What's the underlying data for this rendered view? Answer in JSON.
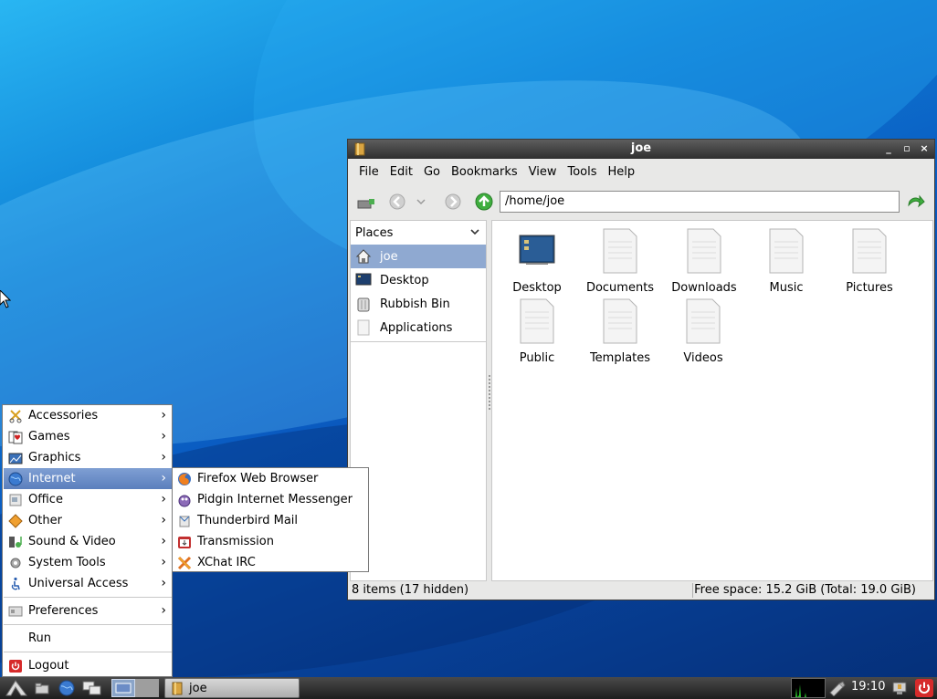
{
  "window": {
    "title": "joe",
    "controls": {
      "minimize": "_",
      "maximize": "▫",
      "close": "×"
    }
  },
  "menubar": {
    "items": [
      {
        "label": "File"
      },
      {
        "label": "Edit"
      },
      {
        "label": "Go"
      },
      {
        "label": "Bookmarks"
      },
      {
        "label": "View"
      },
      {
        "label": "Tools"
      },
      {
        "label": "Help"
      }
    ]
  },
  "toolbar": {
    "location_value": "/home/joe",
    "icons": [
      "new-tab-icon",
      "back-icon",
      "history-dropdown-icon",
      "forward-icon",
      "up-icon",
      "go-icon"
    ]
  },
  "sidebar": {
    "header": "Places",
    "items": [
      {
        "label": "joe",
        "icon": "home-icon",
        "selected": true
      },
      {
        "label": "Desktop",
        "icon": "desktop-icon"
      },
      {
        "label": "Rubbish Bin",
        "icon": "trash-icon"
      },
      {
        "label": "Applications",
        "icon": "applications-icon"
      }
    ]
  },
  "files": [
    {
      "name": "Desktop",
      "icon": "desktop-folder-icon"
    },
    {
      "name": "Documents",
      "icon": "document-icon"
    },
    {
      "name": "Downloads",
      "icon": "document-icon"
    },
    {
      "name": "Music",
      "icon": "document-icon"
    },
    {
      "name": "Pictures",
      "icon": "document-icon"
    },
    {
      "name": "Public",
      "icon": "document-icon"
    },
    {
      "name": "Templates",
      "icon": "document-icon"
    },
    {
      "name": "Videos",
      "icon": "document-icon"
    }
  ],
  "statusbar": {
    "items_text": "8 items (17 hidden)",
    "free_space_text": "Free space: 15.2 GiB (Total: 19.0 GiB)"
  },
  "app_menu": {
    "items": [
      {
        "label": "Accessories",
        "icon": "accessories-icon",
        "submenu": true
      },
      {
        "label": "Games",
        "icon": "games-icon",
        "submenu": true
      },
      {
        "label": "Graphics",
        "icon": "graphics-icon",
        "submenu": true
      },
      {
        "label": "Internet",
        "icon": "internet-icon",
        "submenu": true,
        "active": true
      },
      {
        "label": "Office",
        "icon": "office-icon",
        "submenu": true
      },
      {
        "label": "Other",
        "icon": "other-icon",
        "submenu": true
      },
      {
        "label": "Sound & Video",
        "icon": "sound-video-icon",
        "submenu": true
      },
      {
        "label": "System Tools",
        "icon": "system-tools-icon",
        "submenu": true
      },
      {
        "label": "Universal Access",
        "icon": "universal-access-icon",
        "submenu": true
      },
      {
        "label": "Preferences",
        "icon": "preferences-icon",
        "submenu": true
      },
      {
        "label": "Run",
        "icon": ""
      },
      {
        "label": "Logout",
        "icon": "logout-icon"
      }
    ]
  },
  "internet_submenu": {
    "items": [
      {
        "label": "Firefox Web Browser",
        "icon": "firefox-icon"
      },
      {
        "label": "Pidgin Internet Messenger",
        "icon": "pidgin-icon"
      },
      {
        "label": "Thunderbird Mail",
        "icon": "thunderbird-icon"
      },
      {
        "label": "Transmission",
        "icon": "transmission-icon"
      },
      {
        "label": "XChat IRC",
        "icon": "xchat-icon"
      }
    ]
  },
  "taskbar": {
    "task_label": "joe",
    "clock": "19:10"
  },
  "colors": {
    "menu_highlight": "#6b8cc6",
    "selected_place": "#8fa9d1",
    "titlebar": "#3c3c3c"
  }
}
